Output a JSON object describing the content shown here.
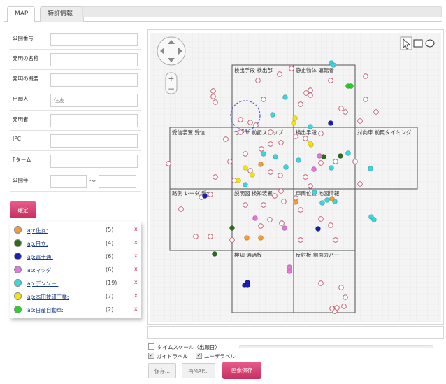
{
  "tabs": [
    {
      "label": "MAP",
      "active": true
    },
    {
      "label": "特許情報",
      "active": false
    }
  ],
  "form": {
    "fields": [
      {
        "label": "公開番号",
        "value": "",
        "placeholder": ""
      },
      {
        "label": "発明の名称",
        "value": "",
        "placeholder": ""
      },
      {
        "label": "発明の概要",
        "value": "",
        "placeholder": ""
      },
      {
        "label": "出願人",
        "value": "",
        "placeholder": "住友"
      },
      {
        "label": "発明者",
        "value": "",
        "placeholder": ""
      },
      {
        "label": "IPC",
        "value": "",
        "placeholder": ""
      },
      {
        "label": "Fターム",
        "value": "",
        "placeholder": ""
      }
    ],
    "year": {
      "label": "公開年",
      "from": "",
      "to": "",
      "separator": "～"
    },
    "confirm_label": "確定"
  },
  "legend": [
    {
      "name": "ap:住友:",
      "count": "(5)",
      "color": "#f39c38",
      "remove": "x"
    },
    {
      "name": "ap:日立:",
      "count": "(4)",
      "color": "#2e6b1f",
      "remove": "x"
    },
    {
      "name": "ap:富士通:",
      "count": "(6)",
      "color": "#1a1fb8",
      "remove": "x"
    },
    {
      "name": "ap:マツダ:",
      "count": "(6)",
      "color": "#e07ad6",
      "remove": "x"
    },
    {
      "name": "ap:デンソー:",
      "count": "(19)",
      "color": "#3fd5dc",
      "remove": "x"
    },
    {
      "name": "ap:本田技研工業:",
      "count": "(7)",
      "color": "#f2e21a",
      "remove": "x"
    },
    {
      "name": "ap:日産自動車:",
      "count": "(2)",
      "color": "#2bd12b",
      "remove": "x"
    }
  ],
  "map": {
    "cell_labels": [
      "検出手段 検出部",
      "静止物体 運転者",
      "受信装置 受信",
      "センサ 前記ステップ",
      "検出手段",
      "対向車 前照タイミング",
      "路側 レーダ 受信",
      "説明図 検知装置",
      "車両位置 地図情報",
      "検知 通過板",
      "反射板 前面カバー"
    ],
    "tools": [
      "pointer-tool",
      "rect-select-tool",
      "ellipse-select-tool"
    ]
  },
  "options": {
    "timescale_label": "タイムスケール（出願日）",
    "timescale_checked": false,
    "guide_label": "ガイドラベル",
    "guide_checked": true,
    "user_label": "ユーザラベル",
    "user_checked": true
  },
  "buttons": {
    "save": "保存...",
    "open_map": "再MAP...",
    "save_image": "画像保存"
  }
}
